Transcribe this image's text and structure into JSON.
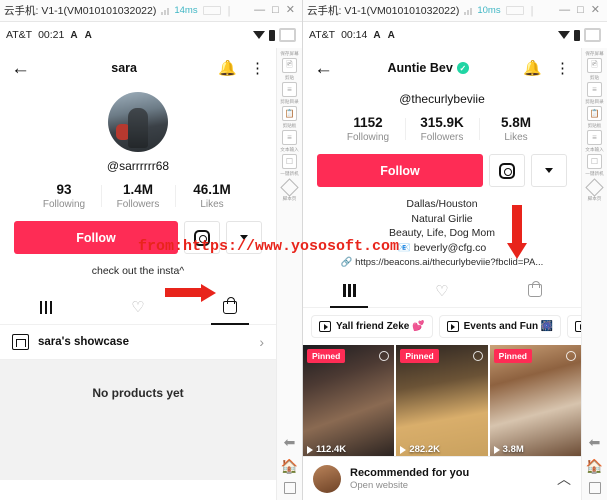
{
  "windows": [
    {
      "titlebar": {
        "title": "云手机: V1-1(VM010101032022)",
        "latency": "14ms",
        "minimize": "—",
        "maximize": "□",
        "close": "✕"
      },
      "statusbar": {
        "carrier": "AT&T",
        "time": "00:21",
        "font_small": "A",
        "font_large": "A"
      },
      "phone": {
        "header": {
          "back": "←",
          "title": "sara",
          "verified": "",
          "bell": "bell-icon",
          "more": "⋮"
        },
        "handle": "@sarrrrrr68",
        "stats": [
          {
            "num": "93",
            "label": "Following"
          },
          {
            "num": "1.4M",
            "label": "Followers"
          },
          {
            "num": "46.1M",
            "label": "Likes"
          }
        ],
        "follow_label": "Follow",
        "bio": "check out the insta^",
        "bio_link": "",
        "tabs": [
          {
            "name": "videos",
            "icon": "grid-icon",
            "active": false
          },
          {
            "name": "liked",
            "icon": "heart-icon",
            "active": false
          },
          {
            "name": "shop",
            "icon": "shopping-bag-icon",
            "active": true
          }
        ],
        "showcase": {
          "name": "sara's showcase",
          "chevron": "›"
        },
        "empty_text": "No products yet"
      }
    },
    {
      "titlebar": {
        "title": "云手机: V1-1(VM010101032022)",
        "latency": "10ms",
        "minimize": "—",
        "maximize": "□",
        "close": "✕"
      },
      "statusbar": {
        "carrier": "AT&T",
        "time": "00:14",
        "font_small": "A",
        "font_large": "A"
      },
      "phone": {
        "header": {
          "back": "←",
          "title": "Auntie Bev",
          "verified": "✓",
          "bell": "bell-icon",
          "more": "⋮"
        },
        "handle": "@thecurlybeviie",
        "stats": [
          {
            "num": "1152",
            "label": "Following"
          },
          {
            "num": "315.9K",
            "label": "Followers"
          },
          {
            "num": "5.8M",
            "label": "Likes"
          }
        ],
        "follow_label": "Follow",
        "bio_lines": [
          "Dallas/Houston",
          "Natural Girlie",
          "Beauty, Life, Dog Mom",
          "📧 beverly@cfg.co"
        ],
        "bio_link": "🔗 https://beacons.ai/thecurlybeviie?fbclid=PA...",
        "tabs": [
          {
            "name": "videos",
            "icon": "grid-icon",
            "active": true
          },
          {
            "name": "liked",
            "icon": "heart-icon",
            "active": false
          },
          {
            "name": "shop",
            "icon": "shopping-bag-icon",
            "active": false
          }
        ],
        "playlists": [
          {
            "label": "Yall friend Zeke 💕"
          },
          {
            "label": "Events and Fun 🎆"
          },
          {
            "label": ""
          }
        ],
        "videos": [
          {
            "pinned_label": "Pinned",
            "views": "112.4K"
          },
          {
            "pinned_label": "Pinned",
            "views": "282.2K"
          },
          {
            "pinned_label": "Pinned",
            "views": "3.8M"
          }
        ],
        "bottom_bar": {
          "title": "Recommended for you",
          "subtitle": "Open website",
          "chevron": "︿"
        }
      }
    }
  ],
  "toolbar": {
    "items": [
      {
        "label": "保存屏幕",
        "icon": "image-icon"
      },
      {
        "label": "剪贴",
        "icon": "list-icon"
      },
      {
        "label": "剪贴目录",
        "icon": "clipboard-icon"
      },
      {
        "label": "剪贴板",
        "icon": "list-icon"
      },
      {
        "label": "文本输入",
        "icon": "text-input-icon"
      },
      {
        "label": "一键新机",
        "icon": "diamond-icon"
      },
      {
        "label": "脚本页",
        "icon": "script-icon"
      }
    ],
    "nav": {
      "back": "back-icon",
      "home": "home-icon",
      "recent": "recent-apps-icon"
    }
  },
  "annotations": {
    "watermark": "from:https://www.yososoft.com",
    "arrow_color": "#e8241b"
  }
}
